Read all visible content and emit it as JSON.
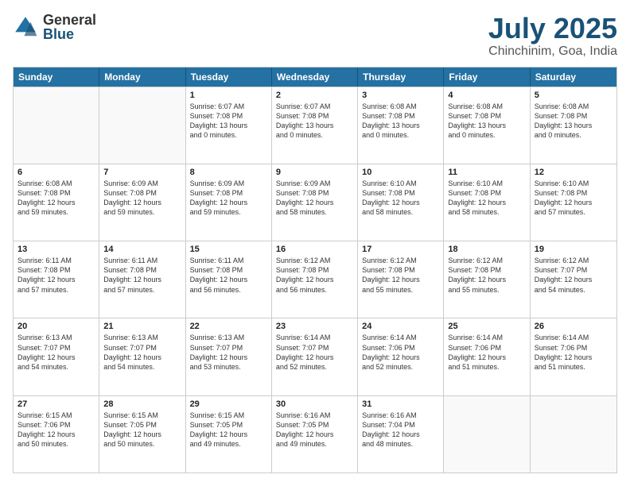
{
  "logo": {
    "general": "General",
    "blue": "Blue"
  },
  "header": {
    "month": "July 2025",
    "location": "Chinchinim, Goa, India"
  },
  "weekdays": [
    "Sunday",
    "Monday",
    "Tuesday",
    "Wednesday",
    "Thursday",
    "Friday",
    "Saturday"
  ],
  "weeks": [
    [
      {
        "day": "",
        "lines": []
      },
      {
        "day": "",
        "lines": []
      },
      {
        "day": "1",
        "lines": [
          "Sunrise: 6:07 AM",
          "Sunset: 7:08 PM",
          "Daylight: 13 hours",
          "and 0 minutes."
        ]
      },
      {
        "day": "2",
        "lines": [
          "Sunrise: 6:07 AM",
          "Sunset: 7:08 PM",
          "Daylight: 13 hours",
          "and 0 minutes."
        ]
      },
      {
        "day": "3",
        "lines": [
          "Sunrise: 6:08 AM",
          "Sunset: 7:08 PM",
          "Daylight: 13 hours",
          "and 0 minutes."
        ]
      },
      {
        "day": "4",
        "lines": [
          "Sunrise: 6:08 AM",
          "Sunset: 7:08 PM",
          "Daylight: 13 hours",
          "and 0 minutes."
        ]
      },
      {
        "day": "5",
        "lines": [
          "Sunrise: 6:08 AM",
          "Sunset: 7:08 PM",
          "Daylight: 13 hours",
          "and 0 minutes."
        ]
      }
    ],
    [
      {
        "day": "6",
        "lines": [
          "Sunrise: 6:08 AM",
          "Sunset: 7:08 PM",
          "Daylight: 12 hours",
          "and 59 minutes."
        ]
      },
      {
        "day": "7",
        "lines": [
          "Sunrise: 6:09 AM",
          "Sunset: 7:08 PM",
          "Daylight: 12 hours",
          "and 59 minutes."
        ]
      },
      {
        "day": "8",
        "lines": [
          "Sunrise: 6:09 AM",
          "Sunset: 7:08 PM",
          "Daylight: 12 hours",
          "and 59 minutes."
        ]
      },
      {
        "day": "9",
        "lines": [
          "Sunrise: 6:09 AM",
          "Sunset: 7:08 PM",
          "Daylight: 12 hours",
          "and 58 minutes."
        ]
      },
      {
        "day": "10",
        "lines": [
          "Sunrise: 6:10 AM",
          "Sunset: 7:08 PM",
          "Daylight: 12 hours",
          "and 58 minutes."
        ]
      },
      {
        "day": "11",
        "lines": [
          "Sunrise: 6:10 AM",
          "Sunset: 7:08 PM",
          "Daylight: 12 hours",
          "and 58 minutes."
        ]
      },
      {
        "day": "12",
        "lines": [
          "Sunrise: 6:10 AM",
          "Sunset: 7:08 PM",
          "Daylight: 12 hours",
          "and 57 minutes."
        ]
      }
    ],
    [
      {
        "day": "13",
        "lines": [
          "Sunrise: 6:11 AM",
          "Sunset: 7:08 PM",
          "Daylight: 12 hours",
          "and 57 minutes."
        ]
      },
      {
        "day": "14",
        "lines": [
          "Sunrise: 6:11 AM",
          "Sunset: 7:08 PM",
          "Daylight: 12 hours",
          "and 57 minutes."
        ]
      },
      {
        "day": "15",
        "lines": [
          "Sunrise: 6:11 AM",
          "Sunset: 7:08 PM",
          "Daylight: 12 hours",
          "and 56 minutes."
        ]
      },
      {
        "day": "16",
        "lines": [
          "Sunrise: 6:12 AM",
          "Sunset: 7:08 PM",
          "Daylight: 12 hours",
          "and 56 minutes."
        ]
      },
      {
        "day": "17",
        "lines": [
          "Sunrise: 6:12 AM",
          "Sunset: 7:08 PM",
          "Daylight: 12 hours",
          "and 55 minutes."
        ]
      },
      {
        "day": "18",
        "lines": [
          "Sunrise: 6:12 AM",
          "Sunset: 7:08 PM",
          "Daylight: 12 hours",
          "and 55 minutes."
        ]
      },
      {
        "day": "19",
        "lines": [
          "Sunrise: 6:12 AM",
          "Sunset: 7:07 PM",
          "Daylight: 12 hours",
          "and 54 minutes."
        ]
      }
    ],
    [
      {
        "day": "20",
        "lines": [
          "Sunrise: 6:13 AM",
          "Sunset: 7:07 PM",
          "Daylight: 12 hours",
          "and 54 minutes."
        ]
      },
      {
        "day": "21",
        "lines": [
          "Sunrise: 6:13 AM",
          "Sunset: 7:07 PM",
          "Daylight: 12 hours",
          "and 54 minutes."
        ]
      },
      {
        "day": "22",
        "lines": [
          "Sunrise: 6:13 AM",
          "Sunset: 7:07 PM",
          "Daylight: 12 hours",
          "and 53 minutes."
        ]
      },
      {
        "day": "23",
        "lines": [
          "Sunrise: 6:14 AM",
          "Sunset: 7:07 PM",
          "Daylight: 12 hours",
          "and 52 minutes."
        ]
      },
      {
        "day": "24",
        "lines": [
          "Sunrise: 6:14 AM",
          "Sunset: 7:06 PM",
          "Daylight: 12 hours",
          "and 52 minutes."
        ]
      },
      {
        "day": "25",
        "lines": [
          "Sunrise: 6:14 AM",
          "Sunset: 7:06 PM",
          "Daylight: 12 hours",
          "and 51 minutes."
        ]
      },
      {
        "day": "26",
        "lines": [
          "Sunrise: 6:14 AM",
          "Sunset: 7:06 PM",
          "Daylight: 12 hours",
          "and 51 minutes."
        ]
      }
    ],
    [
      {
        "day": "27",
        "lines": [
          "Sunrise: 6:15 AM",
          "Sunset: 7:06 PM",
          "Daylight: 12 hours",
          "and 50 minutes."
        ]
      },
      {
        "day": "28",
        "lines": [
          "Sunrise: 6:15 AM",
          "Sunset: 7:05 PM",
          "Daylight: 12 hours",
          "and 50 minutes."
        ]
      },
      {
        "day": "29",
        "lines": [
          "Sunrise: 6:15 AM",
          "Sunset: 7:05 PM",
          "Daylight: 12 hours",
          "and 49 minutes."
        ]
      },
      {
        "day": "30",
        "lines": [
          "Sunrise: 6:16 AM",
          "Sunset: 7:05 PM",
          "Daylight: 12 hours",
          "and 49 minutes."
        ]
      },
      {
        "day": "31",
        "lines": [
          "Sunrise: 6:16 AM",
          "Sunset: 7:04 PM",
          "Daylight: 12 hours",
          "and 48 minutes."
        ]
      },
      {
        "day": "",
        "lines": []
      },
      {
        "day": "",
        "lines": []
      }
    ]
  ]
}
